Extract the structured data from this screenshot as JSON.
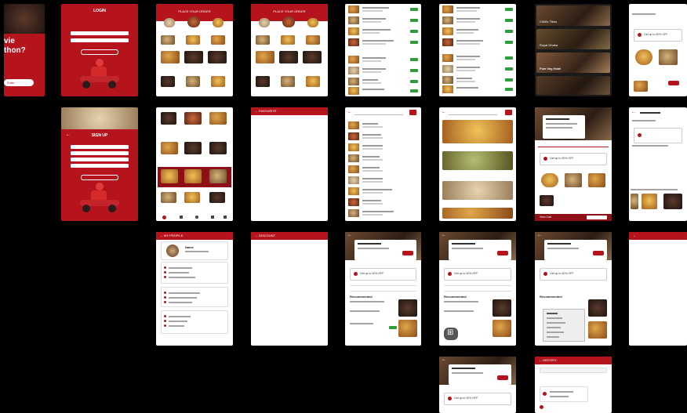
{
  "colors": {
    "brand_red": "#b5141c",
    "dark_red": "#8e0f15",
    "background": "#000000",
    "accept_green": "#2e9a3a"
  },
  "splash": {
    "headline_line1": "vie",
    "headline_line2": "thon?",
    "button_label": "Enter"
  },
  "login": {
    "title": "LOGIN"
  },
  "signup": {
    "title": "SIGN UP"
  },
  "home_a": {
    "header": "PLACE YOUR ORDER"
  },
  "home_b": {
    "header": "PLACE YOUR ORDER"
  },
  "favourite": {
    "title": "FAVOURITE"
  },
  "my_profile": {
    "title": "MY PROFILE",
    "user_name": "Name"
  },
  "discount": {
    "title": "DISCOUNT"
  },
  "restaurant_banners": {
    "banner1": "Chilli's Tikka",
    "banner2": "Royal Dhaba",
    "banner3": "Pure Veg Hotel"
  },
  "offer_text": {
    "label": "Get up to 30% OFF"
  },
  "restaurant_screen": {
    "section_recommended": "Recommended",
    "view_cart": "View Cart"
  },
  "history": {
    "title": "HISTORY"
  }
}
